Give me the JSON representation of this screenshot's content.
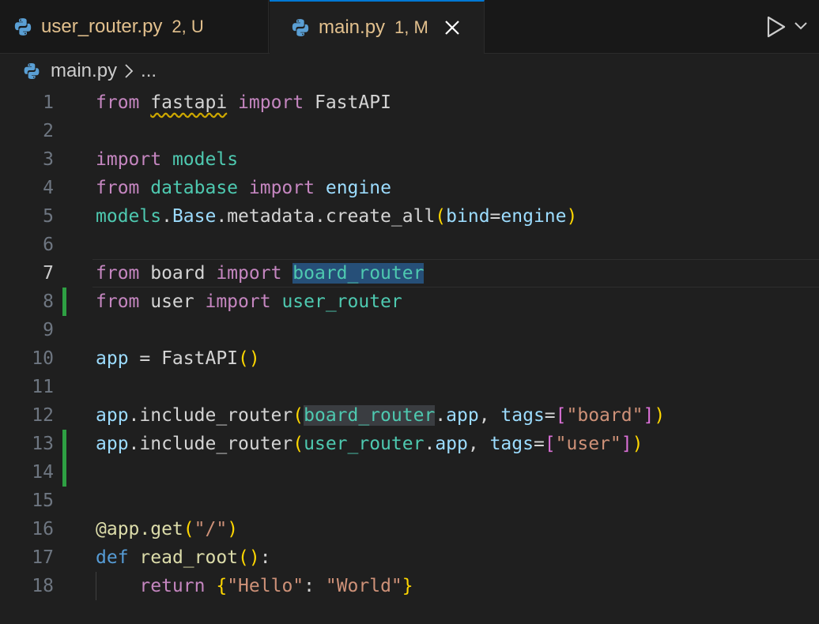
{
  "tabs": [
    {
      "filename": "user_router.py",
      "badge": "2, U"
    },
    {
      "filename": "main.py",
      "badge": "1, M"
    }
  ],
  "breadcrumb": {
    "file": "main.py",
    "more": "..."
  },
  "code": {
    "l1": {
      "num": "1",
      "t1": "from",
      "t2": " ",
      "t3": "fastapi",
      "t4": " ",
      "t5": "import",
      "t6": " FastAPI"
    },
    "l2": {
      "num": "2"
    },
    "l3": {
      "num": "3",
      "t1": "import",
      "t2": " ",
      "t3": "models"
    },
    "l4": {
      "num": "4",
      "t1": "from",
      "t2": " ",
      "t3": "database",
      "t4": " ",
      "t5": "import",
      "t6": " ",
      "t7": "engine"
    },
    "l5": {
      "num": "5",
      "t1": "models",
      "t2": ".",
      "t3": "Base",
      "t4": ".metadata.create_all",
      "t5": "(",
      "t6": "bind",
      "t7": "=",
      "t8": "engine",
      "t9": ")"
    },
    "l6": {
      "num": "6"
    },
    "l7": {
      "num": "7",
      "t1": "from",
      "t2": " board ",
      "t3": "import",
      "t4": " ",
      "t5": "board_router"
    },
    "l8": {
      "num": "8",
      "t1": "from",
      "t2": " user ",
      "t3": "import",
      "t4": " ",
      "t5": "user_router"
    },
    "l9": {
      "num": "9"
    },
    "l10": {
      "num": "10",
      "t1": "app",
      "t2": " = FastAPI",
      "t3": "()"
    },
    "l11": {
      "num": "11"
    },
    "l12": {
      "num": "12",
      "t1": "app",
      "t2": ".include_router",
      "t3": "(",
      "t4": "board_router",
      "t5": ".",
      "t6": "app",
      "t7": ", ",
      "t8": "tags",
      "t9": "=",
      "t10": "[",
      "t11": "\"board\"",
      "t12": "]",
      "t13": ")"
    },
    "l13": {
      "num": "13",
      "t1": "app",
      "t2": ".include_router",
      "t3": "(",
      "t4": "user_router",
      "t5": ".",
      "t6": "app",
      "t7": ", ",
      "t8": "tags",
      "t9": "=",
      "t10": "[",
      "t11": "\"user\"",
      "t12": "]",
      "t13": ")"
    },
    "l14": {
      "num": "14"
    },
    "l15": {
      "num": "15"
    },
    "l16": {
      "num": "16",
      "t1": "@app.get",
      "t2": "(",
      "t3": "\"/\"",
      "t4": ")"
    },
    "l17": {
      "num": "17",
      "t1": "def",
      "t2": " ",
      "t3": "read_root",
      "t4": "()",
      "t5": ":"
    },
    "l18": {
      "num": "18",
      "t1": "    ",
      "t2": "return",
      "t3": " ",
      "t4": "{",
      "t5": "\"Hello\"",
      "t6": ": ",
      "t7": "\"World\"",
      "t8": "}"
    }
  },
  "colors": {
    "accent": "#0078d4",
    "modified": "#2ea043",
    "tabText": "#e2c08d"
  },
  "icons": [
    "python-icon",
    "close-icon",
    "run-icon",
    "chevron-down-icon",
    "chevron-right-icon"
  ]
}
